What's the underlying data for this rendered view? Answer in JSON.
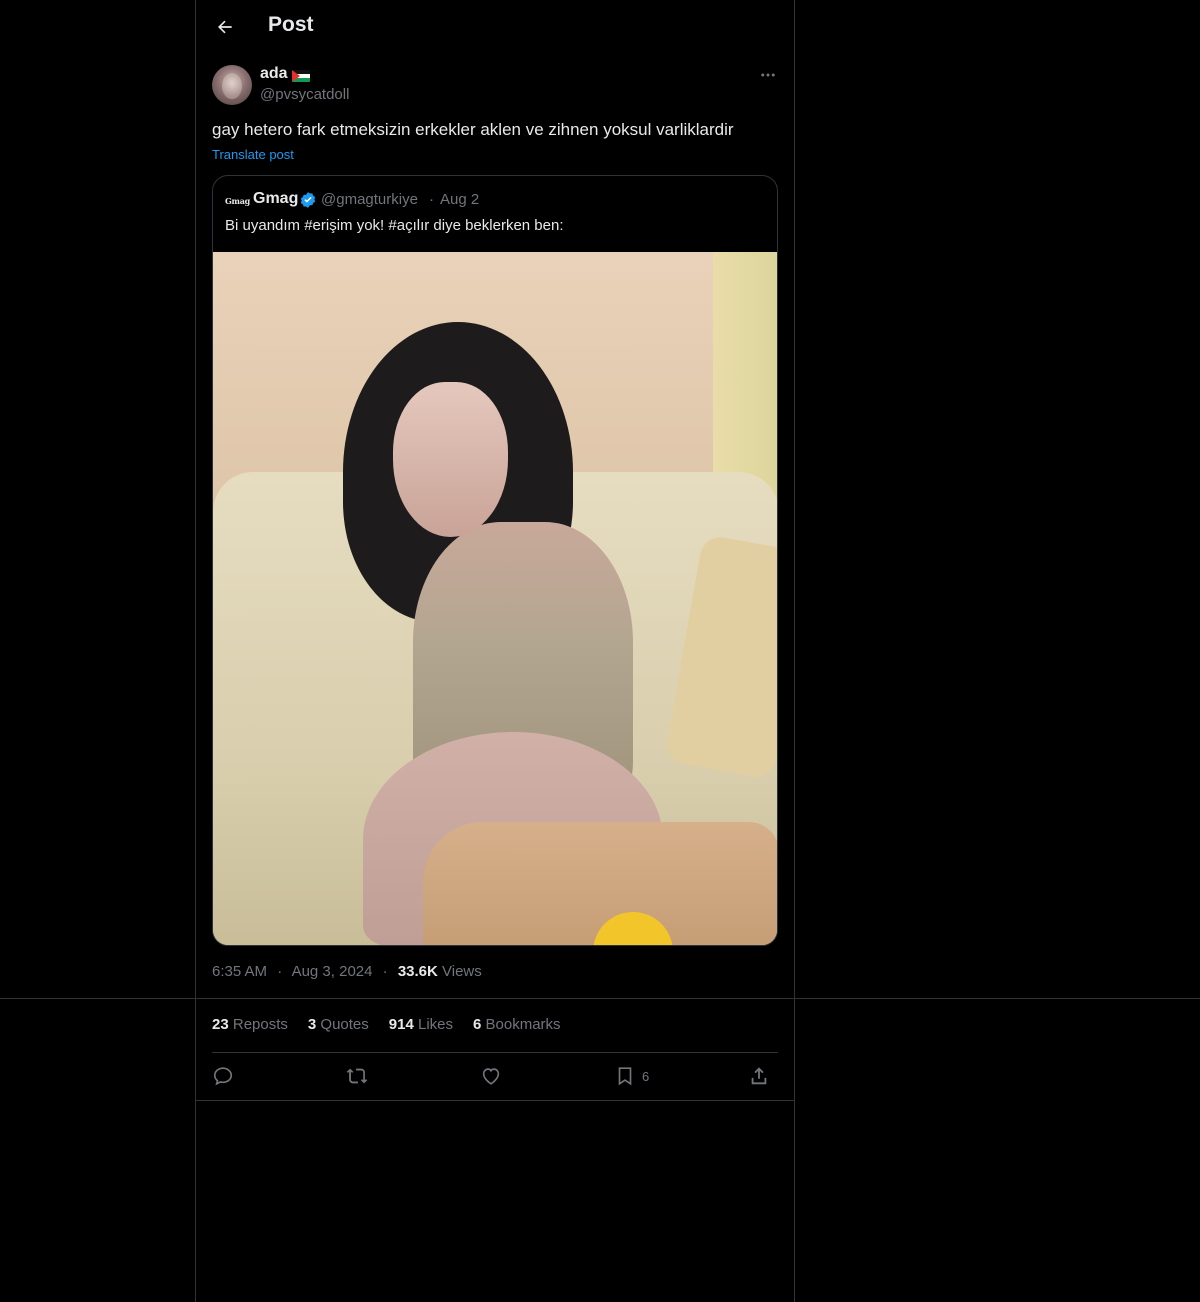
{
  "header": {
    "title": "Post",
    "back_icon": "arrow-left-icon"
  },
  "author": {
    "display_name": "ada",
    "flag_icon": "palestine-flag-icon",
    "handle": "@pvsycatdoll",
    "more_icon": "more-horizontal-icon"
  },
  "post": {
    "text": "gay hetero fark etmeksizin erkekler aklen ve zihnen yoksul varliklardir",
    "translate_label": "Translate post"
  },
  "quote": {
    "logo_text": "Gmag",
    "name": "Gmag",
    "verified_icon": "verified-badge-icon",
    "handle": "@gmagturkiye",
    "separator": "·",
    "date": "Aug 2",
    "text": "Bi uyandım #erişim yok! #açılır diye beklerken ben:"
  },
  "meta": {
    "time": "6:35 AM",
    "separator": "·",
    "date": "Aug 3, 2024",
    "views_count": "33.6K",
    "views_label": "Views"
  },
  "stats": {
    "reposts_count": "23",
    "reposts_label": "Reposts",
    "quotes_count": "3",
    "quotes_label": "Quotes",
    "likes_count": "914",
    "likes_label": "Likes",
    "bookmarks_count": "6",
    "bookmarks_label": "Bookmarks"
  },
  "actions": {
    "reply_icon": "reply-icon",
    "repost_icon": "repost-icon",
    "like_icon": "heart-icon",
    "bookmark_icon": "bookmark-icon",
    "bookmark_count": "6",
    "share_icon": "share-icon"
  },
  "colors": {
    "background": "#000000",
    "text": "#e7e9ea",
    "muted": "#71767b",
    "border": "#2f3336",
    "link": "#1d9bf0"
  }
}
